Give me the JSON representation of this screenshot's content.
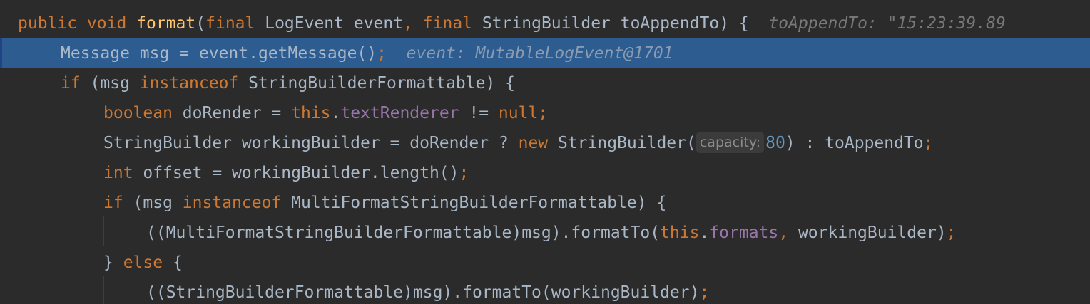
{
  "editor": {
    "lines": [
      {
        "current": false,
        "indent": 0,
        "tokens": [
          {
            "t": "kw",
            "v": "public void "
          },
          {
            "t": "fn",
            "v": "format"
          },
          {
            "t": "txt",
            "v": "("
          },
          {
            "t": "kw",
            "v": "final "
          },
          {
            "t": "txt",
            "v": "LogEvent event"
          },
          {
            "t": "kw",
            "v": ", final "
          },
          {
            "t": "txt",
            "v": "StringBuilder toAppendTo) {  "
          },
          {
            "t": "hint",
            "v": "toAppendTo: \"15:23:39.89"
          }
        ]
      },
      {
        "current": true,
        "indent": 1,
        "tokens": [
          {
            "t": "txt",
            "v": "Message msg = event.getMessage()"
          },
          {
            "t": "kw",
            "v": ";  "
          },
          {
            "t": "hint",
            "v": "event: MutableLogEvent@1701"
          }
        ]
      },
      {
        "current": false,
        "indent": 1,
        "tokens": [
          {
            "t": "kw",
            "v": "if "
          },
          {
            "t": "txt",
            "v": "(msg "
          },
          {
            "t": "kw",
            "v": "instanceof "
          },
          {
            "t": "txt",
            "v": "StringBuilderFormattable) {"
          }
        ]
      },
      {
        "current": false,
        "indent": 2,
        "tokens": [
          {
            "t": "kw",
            "v": "boolean "
          },
          {
            "t": "txt",
            "v": "doRender = "
          },
          {
            "t": "kw",
            "v": "this"
          },
          {
            "t": "txt",
            "v": "."
          },
          {
            "t": "fld",
            "v": "textRenderer"
          },
          {
            "t": "txt",
            "v": " != "
          },
          {
            "t": "kw",
            "v": "null;"
          }
        ]
      },
      {
        "current": false,
        "indent": 2,
        "tokens": [
          {
            "t": "txt",
            "v": "StringBuilder workingBuilder = doRender ? "
          },
          {
            "t": "kw",
            "v": "new "
          },
          {
            "t": "txt",
            "v": "StringBuilder("
          },
          {
            "t": "param",
            "v": "capacity:"
          },
          {
            "t": "num",
            "v": "80"
          },
          {
            "t": "txt",
            "v": ") : toAppendTo"
          },
          {
            "t": "kw",
            "v": ";"
          }
        ]
      },
      {
        "current": false,
        "indent": 2,
        "tokens": [
          {
            "t": "kw",
            "v": "int "
          },
          {
            "t": "txt",
            "v": "offset = workingBuilder.length()"
          },
          {
            "t": "kw",
            "v": ";"
          }
        ]
      },
      {
        "current": false,
        "indent": 2,
        "tokens": [
          {
            "t": "kw",
            "v": "if "
          },
          {
            "t": "txt",
            "v": "(msg "
          },
          {
            "t": "kw",
            "v": "instanceof "
          },
          {
            "t": "txt",
            "v": "MultiFormatStringBuilderFormattable) {"
          }
        ]
      },
      {
        "current": false,
        "indent": 3,
        "tokens": [
          {
            "t": "txt",
            "v": "((MultiFormatStringBuilderFormattable)msg).formatTo("
          },
          {
            "t": "kw",
            "v": "this"
          },
          {
            "t": "txt",
            "v": "."
          },
          {
            "t": "fld",
            "v": "formats"
          },
          {
            "t": "kw",
            "v": ", "
          },
          {
            "t": "txt",
            "v": "workingBuilder)"
          },
          {
            "t": "kw",
            "v": ";"
          }
        ]
      },
      {
        "current": false,
        "indent": 2,
        "tokens": [
          {
            "t": "txt",
            "v": "} "
          },
          {
            "t": "kw",
            "v": "else "
          },
          {
            "t": "txt",
            "v": "{"
          }
        ]
      },
      {
        "current": false,
        "indent": 3,
        "tokens": [
          {
            "t": "txt",
            "v": "((StringBuilderFormattable)msg).formatTo(workingBuilder)"
          },
          {
            "t": "kw",
            "v": ";"
          }
        ]
      }
    ]
  }
}
